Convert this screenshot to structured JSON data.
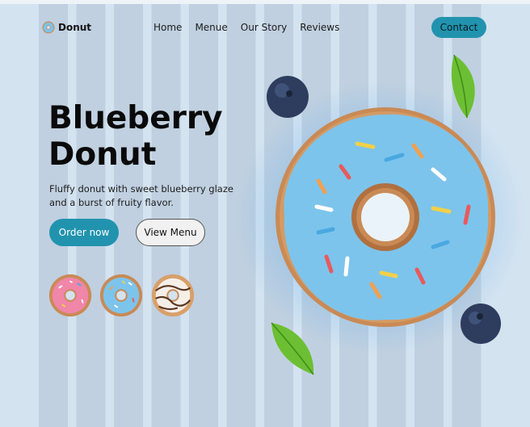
{
  "brand": {
    "logo_text": "Donut"
  },
  "nav": {
    "items": [
      "Home",
      "Menue",
      "Our Story",
      "Reviews"
    ],
    "contact_label": "Contact"
  },
  "hero": {
    "title_line1": "Blueberry",
    "title_line2": "Donut",
    "tagline_line1": "Fluffy donut with  sweet blueberry glaze",
    "tagline_line2": "and a burst of fruity flavor."
  },
  "actions": {
    "order_label": "Order now",
    "view_label": "View Menu"
  },
  "thumbnails": [
    "pink-donut-icon",
    "blue-donut-icon",
    "chocolate-drizzle-donut-icon"
  ],
  "colors": {
    "accent": "#2193ae",
    "background": "#d4e3f0",
    "glaze_blue": "#7cc4ec",
    "dough": "#c98a55",
    "pink_glaze": "#f086a8",
    "leaf_green": "#6cbf32",
    "blueberry": "#2e3d5e"
  }
}
